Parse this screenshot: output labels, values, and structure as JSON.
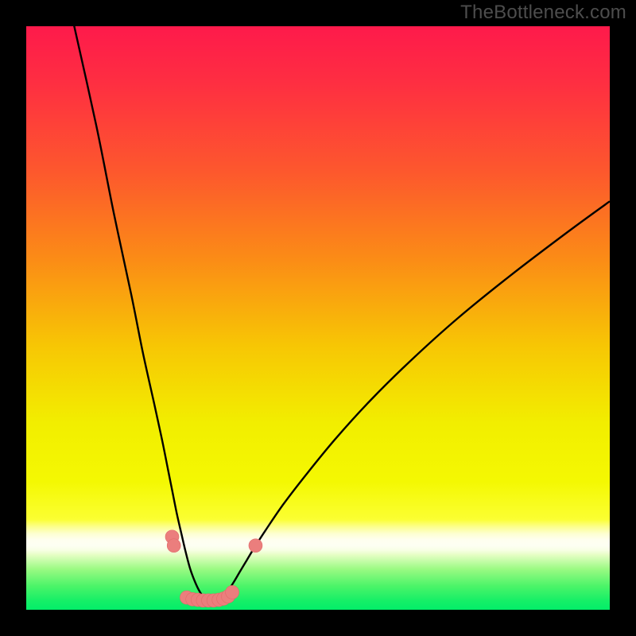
{
  "watermark": "TheBottleneck.com",
  "colors": {
    "frame": "#000000",
    "watermark": "#4d4d4d",
    "curve": "#000000",
    "marker_fill": "#eb7e7d",
    "marker_stroke": "#e06a69",
    "gradient_stops": [
      {
        "offset": 0.0,
        "color": "#fe1a4b"
      },
      {
        "offset": 0.1,
        "color": "#fe2f41"
      },
      {
        "offset": 0.25,
        "color": "#fd582d"
      },
      {
        "offset": 0.4,
        "color": "#fb8c16"
      },
      {
        "offset": 0.55,
        "color": "#f7c704"
      },
      {
        "offset": 0.68,
        "color": "#f2ee00"
      },
      {
        "offset": 0.78,
        "color": "#f4f802"
      },
      {
        "offset": 0.845,
        "color": "#fbff32"
      },
      {
        "offset": 0.858,
        "color": "#fcff8f"
      },
      {
        "offset": 0.87,
        "color": "#fdffd3"
      },
      {
        "offset": 0.88,
        "color": "#feffef"
      },
      {
        "offset": 0.89,
        "color": "#fdfff3"
      },
      {
        "offset": 0.898,
        "color": "#f7ffe4"
      },
      {
        "offset": 0.906,
        "color": "#e5fec4"
      },
      {
        "offset": 0.93,
        "color": "#9bfa83"
      },
      {
        "offset": 0.96,
        "color": "#4af468"
      },
      {
        "offset": 0.985,
        "color": "#15ef67"
      },
      {
        "offset": 1.0,
        "color": "#03ee69"
      }
    ]
  },
  "chart_data": {
    "type": "line",
    "title": "",
    "xlabel": "",
    "ylabel": "",
    "xlim": [
      0,
      100
    ],
    "ylim": [
      0,
      100
    ],
    "series": [
      {
        "name": "left-curve",
        "x": [
          8.0,
          12.0,
          15.0,
          18.0,
          20.0,
          22.0,
          23.3,
          24.3,
          25.0,
          25.8,
          26.6,
          27.3,
          28.1,
          29.0,
          29.8,
          30.6,
          31.5
        ],
        "y": [
          101.0,
          83.0,
          68.0,
          54.0,
          44.0,
          35.0,
          29.0,
          24.0,
          20.5,
          16.5,
          13.0,
          10.0,
          7.0,
          4.6,
          3.0,
          2.0,
          1.6
        ]
      },
      {
        "name": "right-curve",
        "x": [
          32.5,
          33.6,
          34.6,
          35.6,
          36.6,
          37.8,
          39.0,
          41.0,
          44.0,
          48.0,
          53.0,
          59.0,
          66.0,
          74.0,
          83.0,
          93.0,
          100.0
        ],
        "y": [
          1.6,
          2.1,
          3.3,
          4.8,
          6.5,
          8.5,
          10.5,
          13.6,
          18.0,
          23.2,
          29.3,
          35.9,
          42.8,
          50.0,
          57.3,
          64.9,
          70.0
        ]
      }
    ],
    "markers": [
      {
        "x": 25.0,
        "y": 12.5
      },
      {
        "x": 25.3,
        "y": 11.0
      },
      {
        "x": 27.5,
        "y": 2.1
      },
      {
        "x": 28.5,
        "y": 1.8
      },
      {
        "x": 29.4,
        "y": 1.7
      },
      {
        "x": 30.3,
        "y": 1.6
      },
      {
        "x": 31.2,
        "y": 1.6
      },
      {
        "x": 32.1,
        "y": 1.6
      },
      {
        "x": 33.0,
        "y": 1.7
      },
      {
        "x": 33.8,
        "y": 1.9
      },
      {
        "x": 34.6,
        "y": 2.3
      },
      {
        "x": 35.3,
        "y": 3.0
      },
      {
        "x": 39.3,
        "y": 11.0
      }
    ]
  }
}
